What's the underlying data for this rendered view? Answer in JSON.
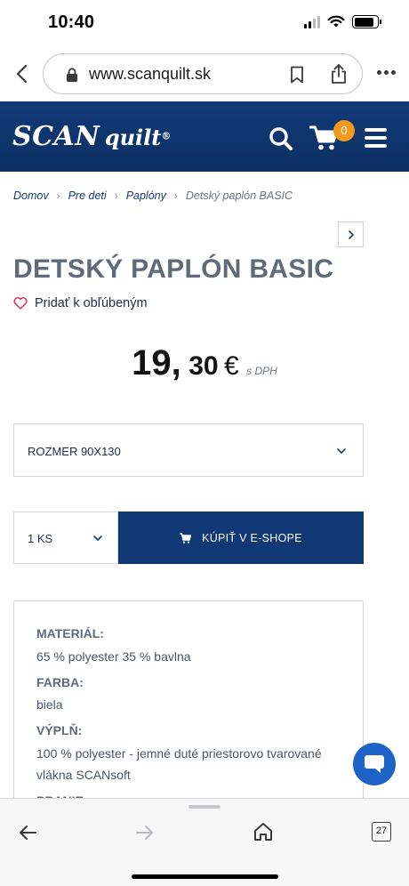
{
  "status_bar": {
    "time": "10:40",
    "battery_level": 0.85
  },
  "browser": {
    "url": "www.scanquilt.sk",
    "tab_count": "27"
  },
  "site": {
    "logo": {
      "scan": "SCAN",
      "quilt": "quilt",
      "reg": "®"
    },
    "cart_count": "0",
    "colors": {
      "brand_navy": "#0f3875",
      "badge_orange": "#f39a1e",
      "chat_blue": "#1d63c8"
    }
  },
  "breadcrumb": [
    {
      "label": "Domov"
    },
    {
      "label": "Pre deti"
    },
    {
      "label": "Paplóny"
    },
    {
      "label": "Detský paplón BASIC"
    }
  ],
  "product": {
    "title": "DETSKÝ PAPLÓN BASIC",
    "favorite_label": "Pridať k obľúbeným",
    "price": {
      "integer": "19,",
      "decimal": "30",
      "currency": "€",
      "vat_note": "s DPH"
    },
    "size_select": {
      "selected": "ROZMER 90X130"
    },
    "quantity_select": {
      "selected": "1 KS"
    },
    "buy_label": "KÚPIŤ V E-SHOPE"
  },
  "specs": [
    {
      "label": "MATERIÁL:",
      "value": "65 % polyester 35 % bavlna"
    },
    {
      "label": "FARBA:",
      "value": "biela"
    },
    {
      "label": "VÝPLŇ:",
      "value": "100 % polyester - jemné duté priestorovo tvarované vlákna SCANsoft"
    },
    {
      "label": "PRANIE:",
      "value": ""
    }
  ],
  "icons": {
    "back": "chevron-left-icon",
    "lock": "lock-icon",
    "bookmark": "bookmark-icon",
    "share": "share-icon",
    "more": "more-icon",
    "search": "search-icon",
    "cart": "cart-icon",
    "menu": "hamburger-menu-icon",
    "heart": "heart-icon",
    "chat": "chat-icon"
  }
}
